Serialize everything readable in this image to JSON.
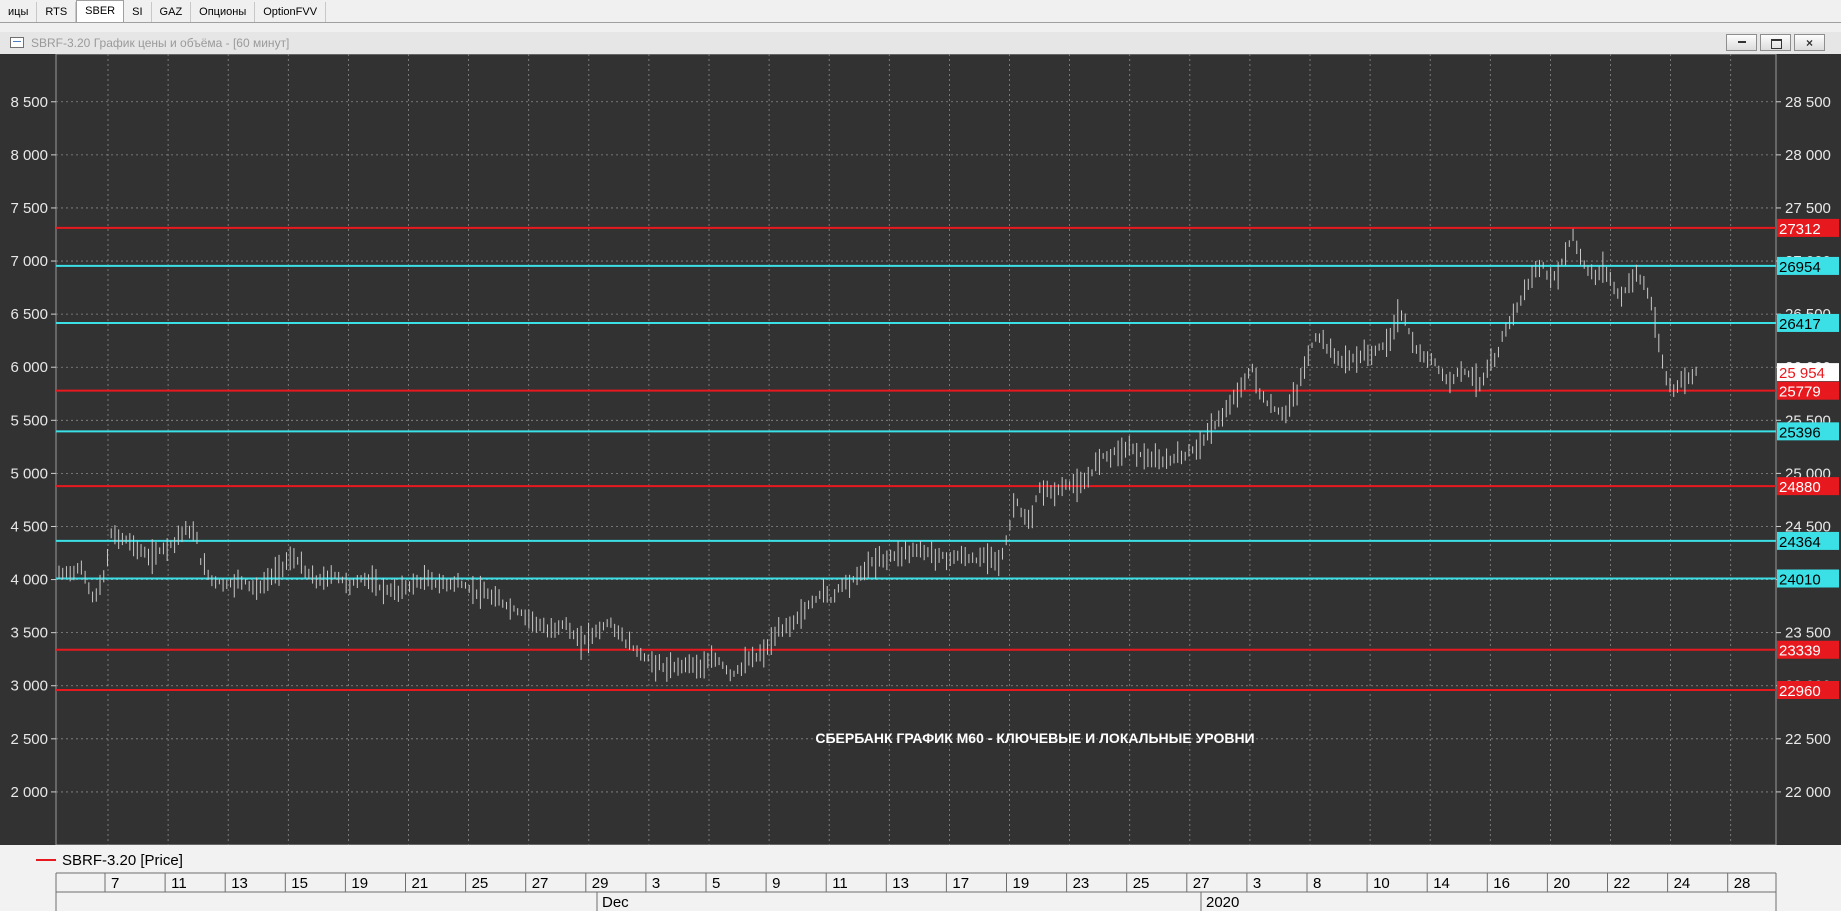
{
  "tabs": [
    "ицы",
    "RTS",
    "SBER",
    "SI",
    "GAZ",
    "Опционы",
    "OptionFVV"
  ],
  "active_tab": "SBER",
  "window": {
    "title": "SBRF-3.20 График цены и объёма - [60 минут]"
  },
  "colors": {
    "background": "#323232",
    "grid": "#8a8a8a",
    "price": "#c8c8c8",
    "level_red": "#e8191e",
    "level_cyan": "#3be0e6",
    "last_price": "#e8191e"
  },
  "chart_data": {
    "type": "bar",
    "title": "СБЕРБАНК ГРАФИК М60 - КЛЮЧЕВЫЕ И ЛОКАЛЬНЫЕ УРОВНИ",
    "legend": "SBRF-3.20 [Price]",
    "legend_position": "bottom-left",
    "grid": true,
    "ylim": [
      21500,
      28950
    ],
    "y_ticks": [
      22000,
      22500,
      23000,
      23500,
      24000,
      24500,
      25000,
      25500,
      26000,
      26500,
      27000,
      27500,
      28000,
      28500
    ],
    "y_tick_labels_left": [
      "2 000",
      "2 500",
      "3 000",
      "3 500",
      "4 000",
      "4 500",
      "5 000",
      "5 500",
      "6 000",
      "6 500",
      "7 000",
      "7 500",
      "8 000",
      "8 500"
    ],
    "y_tick_labels_right": [
      "22 000",
      "22 500",
      "23 000",
      "23 500",
      "24 000",
      "24 500",
      "25 000",
      "25 500",
      "26 000",
      "26 500",
      "27 000",
      "27 500",
      "28 000",
      "28 500"
    ],
    "x_tick_labels": [
      "7",
      "11",
      "13",
      "15",
      "19",
      "21",
      "25",
      "27",
      "29",
      "3",
      "5",
      "9",
      "11",
      "13",
      "17",
      "19",
      "23",
      "25",
      "27",
      "3",
      "8",
      "10",
      "14",
      "16",
      "20",
      "22",
      "24",
      "28"
    ],
    "x_month_labels": [
      "Dec",
      "2020"
    ],
    "levels": [
      {
        "value": 27312,
        "label": "27312",
        "color": "red"
      },
      {
        "value": 26954,
        "label": "26954",
        "color": "cyan"
      },
      {
        "value": 26417,
        "label": "26417",
        "color": "cyan"
      },
      {
        "value": 25779,
        "label": "25779",
        "color": "red"
      },
      {
        "value": 25396,
        "label": "25396",
        "color": "cyan"
      },
      {
        "value": 24880,
        "label": "24880",
        "color": "red"
      },
      {
        "value": 24364,
        "label": "24364",
        "color": "cyan"
      },
      {
        "value": 24010,
        "label": "24010",
        "color": "cyan"
      },
      {
        "value": 23339,
        "label": "23339",
        "color": "red"
      },
      {
        "value": 22960,
        "label": "22960",
        "color": "red"
      }
    ],
    "last_price": {
      "value": 25954,
      "label": "25 954"
    },
    "price_path": [
      [
        0,
        24050
      ],
      [
        0.015,
        24100
      ],
      [
        0.023,
        23800
      ],
      [
        0.03,
        24050
      ],
      [
        0.034,
        24420
      ],
      [
        0.045,
        24370
      ],
      [
        0.055,
        24250
      ],
      [
        0.06,
        24200
      ],
      [
        0.068,
        24300
      ],
      [
        0.075,
        24350
      ],
      [
        0.082,
        24480
      ],
      [
        0.09,
        24400
      ],
      [
        0.093,
        24150
      ],
      [
        0.1,
        24000
      ],
      [
        0.11,
        23950
      ],
      [
        0.12,
        24000
      ],
      [
        0.13,
        23900
      ],
      [
        0.14,
        24050
      ],
      [
        0.15,
        24180
      ],
      [
        0.155,
        24200
      ],
      [
        0.162,
        24050
      ],
      [
        0.17,
        23980
      ],
      [
        0.18,
        24050
      ],
      [
        0.19,
        23950
      ],
      [
        0.2,
        24020
      ],
      [
        0.21,
        23920
      ],
      [
        0.22,
        23880
      ],
      [
        0.23,
        23950
      ],
      [
        0.24,
        24000
      ],
      [
        0.25,
        23950
      ],
      [
        0.26,
        23980
      ],
      [
        0.27,
        23900
      ],
      [
        0.28,
        23850
      ],
      [
        0.29,
        23780
      ],
      [
        0.3,
        23700
      ],
      [
        0.31,
        23620
      ],
      [
        0.32,
        23500
      ],
      [
        0.33,
        23600
      ],
      [
        0.34,
        23400
      ],
      [
        0.35,
        23500
      ],
      [
        0.36,
        23600
      ],
      [
        0.37,
        23420
      ],
      [
        0.38,
        23300
      ],
      [
        0.39,
        23200
      ],
      [
        0.4,
        23150
      ],
      [
        0.41,
        23220
      ],
      [
        0.42,
        23180
      ],
      [
        0.43,
        23250
      ],
      [
        0.44,
        23100
      ],
      [
        0.45,
        23230
      ],
      [
        0.46,
        23300
      ],
      [
        0.47,
        23500
      ],
      [
        0.48,
        23600
      ],
      [
        0.49,
        23750
      ],
      [
        0.5,
        23900
      ],
      [
        0.505,
        23800
      ],
      [
        0.51,
        23950
      ],
      [
        0.52,
        24000
      ],
      [
        0.53,
        24150
      ],
      [
        0.54,
        24200
      ],
      [
        0.55,
        24250
      ],
      [
        0.56,
        24280
      ],
      [
        0.57,
        24250
      ],
      [
        0.58,
        24200
      ],
      [
        0.59,
        24220
      ],
      [
        0.6,
        24180
      ],
      [
        0.61,
        24250
      ],
      [
        0.615,
        24150
      ],
      [
        0.62,
        24400
      ],
      [
        0.625,
        24780
      ],
      [
        0.63,
        24600
      ],
      [
        0.635,
        24500
      ],
      [
        0.64,
        24850
      ],
      [
        0.65,
        24820
      ],
      [
        0.66,
        24900
      ],
      [
        0.67,
        24880
      ],
      [
        0.68,
        25150
      ],
      [
        0.69,
        25200
      ],
      [
        0.7,
        25250
      ],
      [
        0.71,
        25150
      ],
      [
        0.72,
        25100
      ],
      [
        0.73,
        25150
      ],
      [
        0.74,
        25200
      ],
      [
        0.75,
        25350
      ],
      [
        0.76,
        25550
      ],
      [
        0.765,
        25600
      ],
      [
        0.77,
        25780
      ],
      [
        0.775,
        25850
      ],
      [
        0.78,
        26000
      ],
      [
        0.785,
        25750
      ],
      [
        0.79,
        25650
      ],
      [
        0.8,
        25550
      ],
      [
        0.805,
        25650
      ],
      [
        0.81,
        25800
      ],
      [
        0.815,
        26050
      ],
      [
        0.82,
        26250
      ],
      [
        0.825,
        26300
      ],
      [
        0.83,
        26150
      ],
      [
        0.84,
        26050
      ],
      [
        0.85,
        26100
      ],
      [
        0.86,
        26150
      ],
      [
        0.87,
        26250
      ],
      [
        0.875,
        26500
      ],
      [
        0.88,
        26450
      ],
      [
        0.885,
        26200
      ],
      [
        0.89,
        26100
      ],
      [
        0.9,
        26050
      ],
      [
        0.905,
        25900
      ],
      [
        0.91,
        25850
      ],
      [
        0.915,
        26000
      ],
      [
        0.92,
        25950
      ],
      [
        0.925,
        25900
      ],
      [
        0.93,
        25850
      ],
      [
        0.935,
        26000
      ],
      [
        0.94,
        26100
      ],
      [
        0.945,
        26350
      ],
      [
        0.95,
        26500
      ],
      [
        0.955,
        26600
      ],
      [
        0.96,
        26800
      ],
      [
        0.965,
        26900
      ],
      [
        0.97,
        26950
      ],
      [
        0.975,
        26800
      ],
      [
        0.98,
        26900
      ],
      [
        0.985,
        27100
      ],
      [
        0.99,
        27250
      ],
      [
        0.995,
        27000
      ],
      [
        1.0,
        26900
      ],
      [
        1.005,
        26850
      ],
      [
        1.01,
        26950
      ],
      [
        1.015,
        26800
      ],
      [
        1.02,
        26650
      ],
      [
        1.025,
        26750
      ],
      [
        1.03,
        26900
      ],
      [
        1.035,
        26800
      ],
      [
        1.04,
        26650
      ],
      [
        1.045,
        26250
      ],
      [
        1.05,
        25900
      ],
      [
        1.055,
        25800
      ],
      [
        1.06,
        25850
      ],
      [
        1.065,
        25900
      ],
      [
        1.07,
        25954
      ]
    ]
  }
}
